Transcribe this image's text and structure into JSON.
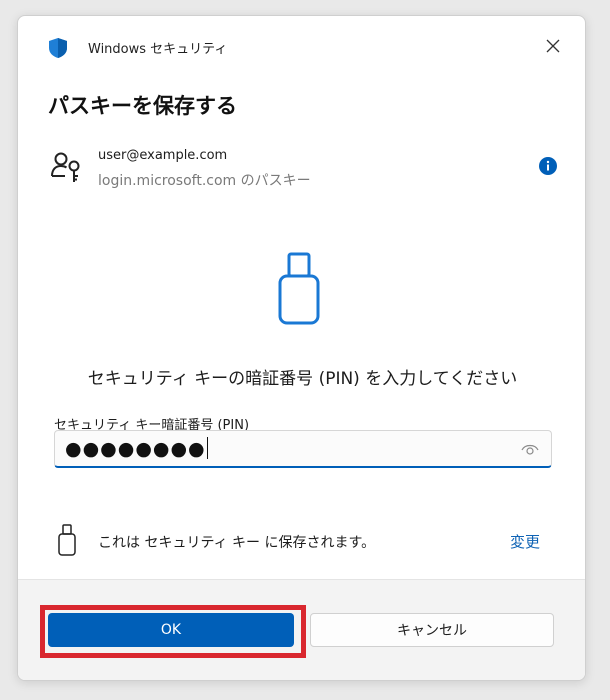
{
  "window": {
    "app_title": "Windows セキュリティ",
    "heading": "パスキーを保存する"
  },
  "account": {
    "email": "user@example.com",
    "subtitle": "login.microsoft.com のパスキー"
  },
  "pin": {
    "prompt": "セキュリティ キーの暗証番号 (PIN) を入力してください",
    "label": "セキュリティ キー暗証番号 (PIN)",
    "masked_value": "●●●●●●●●"
  },
  "storage": {
    "text": "これは セキュリティ キー に保存されます。",
    "change_link": "変更"
  },
  "buttons": {
    "ok": "OK",
    "cancel": "キャンセル"
  },
  "colors": {
    "accent": "#005fb8",
    "highlight": "#d9272e",
    "link": "#0f63b5"
  },
  "icons": [
    "shield-icon",
    "close-icon",
    "passkey-icon",
    "info-icon",
    "usb-key-icon",
    "eye-icon"
  ]
}
